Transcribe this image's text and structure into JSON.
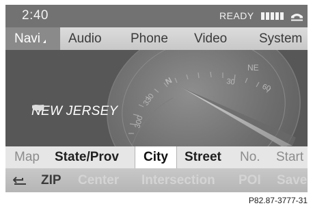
{
  "status_bar": {
    "time": "2:40",
    "ready_text": "READY",
    "signal_bars": 5,
    "icons": [
      "signal-strength-icon",
      "phone-handset-icon"
    ]
  },
  "main_menu": {
    "items": [
      {
        "label": "Navi",
        "selected": true
      },
      {
        "label": "Audio",
        "selected": false
      },
      {
        "label": "Phone",
        "selected": false
      },
      {
        "label": "Video",
        "selected": false
      },
      {
        "label": "System",
        "selected": false
      }
    ]
  },
  "map": {
    "state_name": "NEW JERSEY",
    "state_icon": "us-map-icon",
    "compass_labels": [
      "NE",
      "N",
      "330",
      "300",
      "30",
      "60"
    ]
  },
  "address_tabs": {
    "items": [
      {
        "label": "Map",
        "style": "dim"
      },
      {
        "label": "State/Prov",
        "style": "bold"
      },
      {
        "label": "City",
        "style": "selected"
      },
      {
        "label": "Street",
        "style": "bold"
      },
      {
        "label": "No.",
        "style": "dim"
      },
      {
        "label": "Start",
        "style": "dim"
      }
    ]
  },
  "bottom_bar": {
    "back_icon": "back-arrow-icon",
    "items": [
      {
        "label": "ZIP",
        "enabled": true
      },
      {
        "label": "Center",
        "enabled": false
      },
      {
        "label": "Intersection",
        "enabled": false
      },
      {
        "label": "POI",
        "enabled": false
      },
      {
        "label": "Save",
        "enabled": false
      }
    ]
  },
  "figure_code": "P82.87-3777-31",
  "colors": {
    "screen_bg": "#6d6d6d",
    "menu_bg": "#d4d4d4",
    "selected_menu_bg": "#8a8a8a",
    "tab_selected_bg": "#ffffff",
    "inactive_text": "#d4d4d4"
  }
}
